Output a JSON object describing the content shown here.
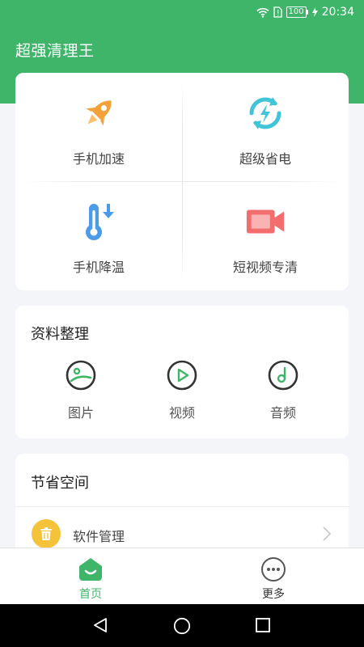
{
  "status_bar": {
    "battery": "100",
    "time": "20:34"
  },
  "app": {
    "title": "超强清理王"
  },
  "tools": [
    {
      "label": "手机加速",
      "icon": "rocket-icon"
    },
    {
      "label": "超级省电",
      "icon": "lightning-refresh-icon"
    },
    {
      "label": "手机降温",
      "icon": "thermometer-icon"
    },
    {
      "label": "短视频专清",
      "icon": "video-camera-icon"
    }
  ],
  "data_section": {
    "title": "资料整理",
    "items": [
      {
        "label": "图片",
        "icon": "image-icon"
      },
      {
        "label": "视频",
        "icon": "play-icon"
      },
      {
        "label": "音频",
        "icon": "music-note-icon"
      }
    ]
  },
  "space_section": {
    "title": "节省空间",
    "items": [
      {
        "label": "软件管理",
        "icon": "trash-icon"
      }
    ]
  },
  "bottom_nav": [
    {
      "label": "首页",
      "icon": "home-icon",
      "active": true
    },
    {
      "label": "更多",
      "icon": "more-icon",
      "active": false
    }
  ],
  "colors": {
    "brand_green": "#3fb56a",
    "accent_orange": "#f3a23a",
    "accent_cyan": "#41c4d8",
    "accent_blue": "#4a9be8",
    "accent_red": "#f26d6d",
    "trash_yellow": "#f5c33a"
  }
}
